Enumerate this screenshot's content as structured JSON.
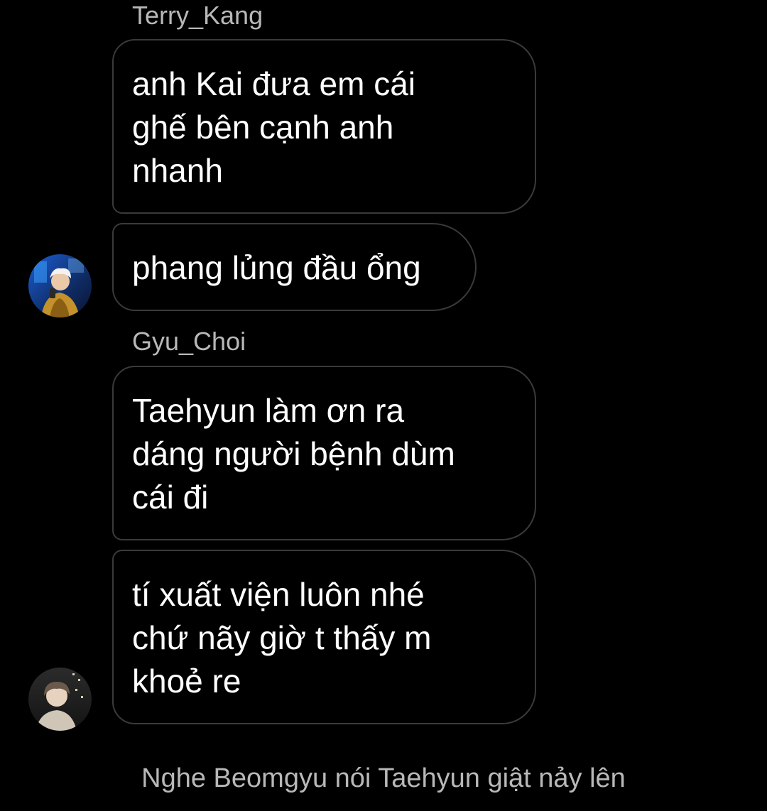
{
  "messages": [
    {
      "sender": "Terry_Kang",
      "bubbles": [
        {
          "lines": [
            "anh Kai đưa em cái",
            "ghế bên cạnh anh",
            "nhanh"
          ]
        },
        {
          "lines": [
            "phang lủng đầu ổng"
          ]
        }
      ],
      "avatar": "avatar-photo-terry"
    },
    {
      "sender": "Gyu_Choi",
      "bubbles": [
        {
          "lines": [
            "Taehyun làm ơn ra",
            "dáng người bệnh dùm",
            "cái đi"
          ]
        },
        {
          "lines": [
            "tí xuất viện luôn nhé",
            "chứ nãy giờ t thấy m",
            "khoẻ re"
          ]
        }
      ],
      "avatar": "avatar-photo-gyu"
    }
  ],
  "system_note": "Nghe Beomgyu nói Taehyun giật nảy lên",
  "colors": {
    "background": "#000000",
    "bubble_border": "#3a3a3a",
    "text": "#ffffff",
    "muted_text": "#b8b8b8"
  }
}
